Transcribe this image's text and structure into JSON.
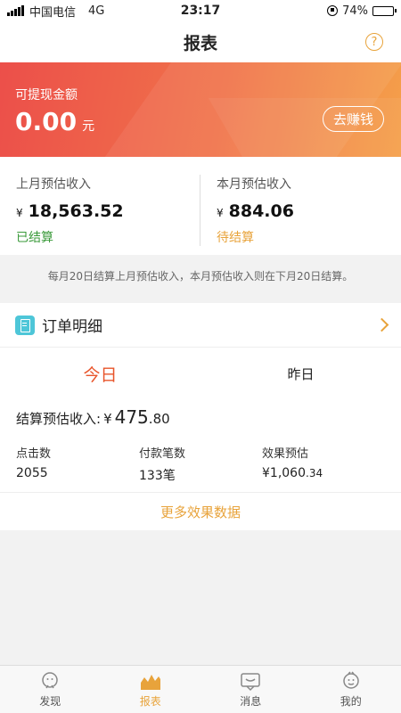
{
  "status_bar": {
    "carrier": "中国电信",
    "network": "4G",
    "time": "23:17",
    "battery": "74%",
    "battery_level": 0.74
  },
  "nav": {
    "title": "报表",
    "help_glyph": "?"
  },
  "balance": {
    "label": "可提现金额",
    "amount": "0.00",
    "unit": "元",
    "action": "去赚钱"
  },
  "income": {
    "last_month": {
      "label": "上月预估收入",
      "currency": "¥",
      "value": "18,563.52",
      "status": "已结算",
      "status_color": "#3a9a3a"
    },
    "this_month": {
      "label": "本月预估收入",
      "currency": "¥",
      "value": "884.06",
      "status": "待结算",
      "status_color": "#e8a33b"
    }
  },
  "note": "每月20日结算上月预估收入，本月预估收入则在下月20日结算。",
  "orders": {
    "title": "订单明细"
  },
  "stats": {
    "tabs": [
      {
        "label": "今日",
        "active": true
      },
      {
        "label": "昨日",
        "active": false
      }
    ],
    "settle_label": "结算预估收入:",
    "settle_currency": "¥",
    "settle_int": "475",
    "settle_dec": ".80",
    "metrics": [
      {
        "label": "点击数",
        "value": "2055"
      },
      {
        "label": "付款笔数",
        "value": "133笔"
      },
      {
        "label": "效果预估",
        "value": "¥1,060",
        "dec": ".34"
      }
    ],
    "more": "更多效果数据"
  },
  "tabbar": {
    "items": [
      {
        "label": "发现",
        "icon": "discover-icon",
        "active": false
      },
      {
        "label": "报表",
        "icon": "report-icon",
        "active": true
      },
      {
        "label": "消息",
        "icon": "message-icon",
        "active": false
      },
      {
        "label": "我的",
        "icon": "profile-icon",
        "active": false
      }
    ]
  },
  "colors": {
    "accent": "#e8a33b",
    "active_tab": "#e8542a",
    "banner_start": "#ec4f4a",
    "banner_end": "#f5a04a"
  }
}
